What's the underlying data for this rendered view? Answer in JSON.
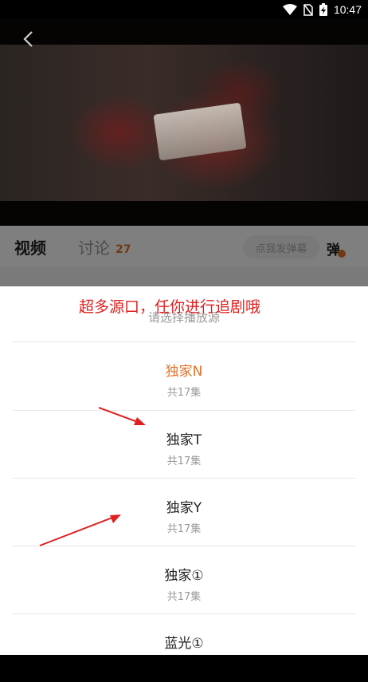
{
  "status_bar": {
    "time": "10:47"
  },
  "tabs": {
    "video_label": "视频",
    "discuss_label": "讨论",
    "discuss_count": "27"
  },
  "danmu": {
    "input_placeholder": "点我发弹幕",
    "toggle_label": "弹"
  },
  "annotation": {
    "text": "超多源口，任你进行追剧哦"
  },
  "sheet": {
    "title": "请选择播放源",
    "sources": [
      {
        "name": "独家N",
        "count": "共17集",
        "active": true
      },
      {
        "name": "独家T",
        "count": "共17集",
        "active": false
      },
      {
        "name": "独家Y",
        "count": "共17集",
        "active": false
      },
      {
        "name": "独家①",
        "count": "共17集",
        "active": false
      },
      {
        "name": "蓝光①",
        "count": "",
        "active": false
      }
    ]
  },
  "colors": {
    "accent": "#e0732b",
    "annotation": "#e02020"
  }
}
